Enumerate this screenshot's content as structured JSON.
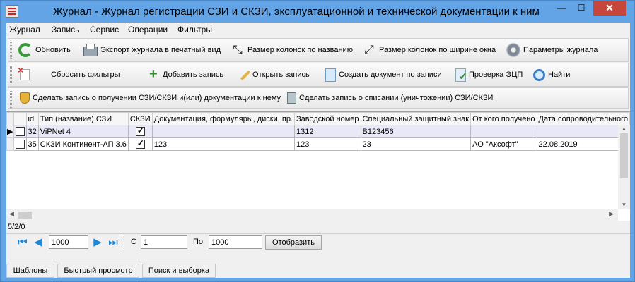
{
  "window": {
    "title": "Журнал - Журнал регистрации СЗИ и СКЗИ, эксплуатационной и технической документации к ним",
    "controls": {
      "minimize": "—",
      "maximize": "☐",
      "close": "✕"
    }
  },
  "menu": [
    "Журнал",
    "Запись",
    "Сервис",
    "Операции",
    "Фильтры"
  ],
  "toolbar1": [
    {
      "label": "Обновить",
      "icon": "refresh-icon"
    },
    {
      "label": "Экспорт журнала в печатный вид",
      "icon": "print-icon"
    },
    {
      "label": "Размер колонок по названию",
      "icon": "arrows-in-icon"
    },
    {
      "label": "Размер колонок по ширине окна",
      "icon": "arrows-out-icon"
    },
    {
      "label": "Параметры журнала",
      "icon": "gear-icon"
    }
  ],
  "toolbar2": [
    {
      "label": "Сбросить фильтры",
      "icon": "reset-filter-icon"
    },
    {
      "label": "Добавить запись",
      "icon": "add-icon"
    },
    {
      "label": "Открыть запись",
      "icon": "edit-icon"
    },
    {
      "label": "Создать документ по записи",
      "icon": "document-icon"
    },
    {
      "label": "Проверка ЭЦП",
      "icon": "signature-check-icon"
    },
    {
      "label": "Найти",
      "icon": "search-icon"
    }
  ],
  "toolbar3": [
    {
      "label": "Сделать запись о получении СЗИ/СКЗИ и(или) документации к нему",
      "icon": "shield-icon"
    },
    {
      "label": "Сделать запись о списании (уничтожении) СЗИ/СКЗИ",
      "icon": "trash-icon"
    }
  ],
  "table": {
    "columns": [
      "id",
      "Тип (название) СЗИ",
      "СКЗИ",
      "Документация, формуляры, диски, пр.",
      "Заводской номер",
      "Специальный защитный знак",
      "От кого получено",
      "Дата сопроводительного"
    ],
    "rows": [
      {
        "id": "32",
        "checked": false,
        "type": "ViPNet 4",
        "skzi": true,
        "docs": "",
        "serial": "1312",
        "mark": "В123456",
        "from": "",
        "date": "",
        "selected": true
      },
      {
        "id": "35",
        "checked": false,
        "type": "СКЗИ Континент-АП  3.6",
        "skzi": true,
        "docs": "123",
        "serial": "123",
        "mark": "23",
        "from": "АО \"Аксофт\"",
        "date": "22.08.2019",
        "selected": false
      }
    ]
  },
  "status": "5/2/0",
  "pager": {
    "page_size": "1000",
    "from_label": "С",
    "from_value": "1",
    "to_label": "По",
    "to_value": "1000",
    "show_button": "Отобразить"
  },
  "tabs": [
    "Шаблоны",
    "Быстрый просмотр",
    "Поиск и выборка"
  ]
}
